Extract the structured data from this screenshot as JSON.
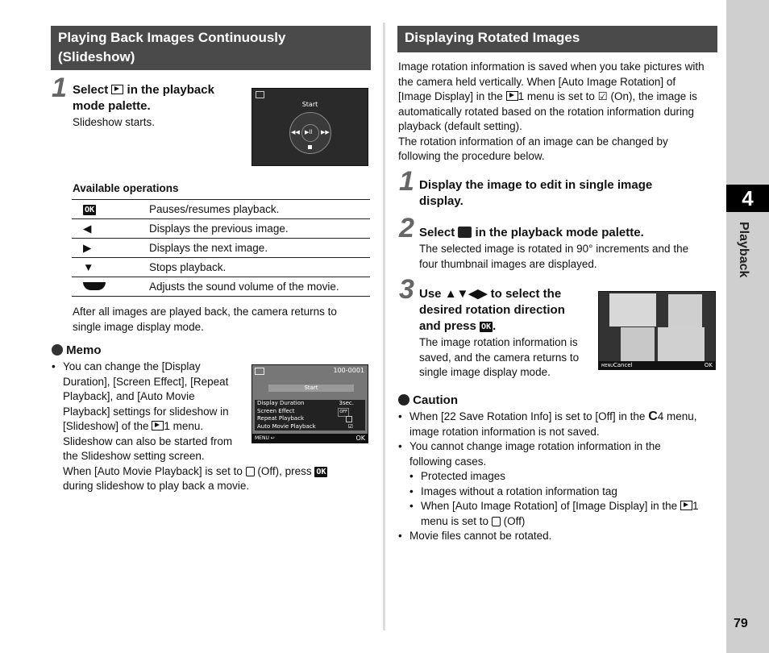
{
  "left": {
    "section_title_line1": "Playing Back Images Continuously",
    "section_title_line2": "(Slideshow)",
    "step1": {
      "number": "1",
      "title_prefix": "Select",
      "title_icon": "slideshow-icon",
      "title_suffix": "in the playback",
      "title_line2": "mode palette.",
      "body": "Slideshow starts."
    },
    "screen1": {
      "label": "Start"
    },
    "operations": {
      "heading": "Available operations",
      "rows": [
        {
          "key_icon": "ok-button-icon",
          "key_text": "OK",
          "desc": "Pauses/resumes playback."
        },
        {
          "key_icon": "left-arrow-icon",
          "key_text": "◀",
          "desc": "Displays the previous image."
        },
        {
          "key_icon": "right-arrow-icon",
          "key_text": "▶",
          "desc": "Displays the next image."
        },
        {
          "key_icon": "down-arrow-icon",
          "key_text": "▼",
          "desc": "Stops playback."
        },
        {
          "key_icon": "rear-dial-icon",
          "key_text": "",
          "desc": "Adjusts the sound volume of the movie."
        }
      ]
    },
    "after_text_line1": "After all images are played back, the camera returns to",
    "after_text_line2": "single image display mode.",
    "memo": {
      "title": "Memo",
      "lines": [
        "You can change the [Display",
        "Duration], [Screen Effect], [Repeat",
        "Playback], and [Auto Movie",
        "Playback] settings for slideshow in",
        "[Slideshow] of the",
        "1 menu.",
        "Slideshow can also be started from",
        "the Slideshow setting screen.",
        "When [Auto Movie Playback] is set to",
        "(Off), press",
        "during slideshow to play back a movie."
      ]
    },
    "screen2": {
      "file_no": "100-0001",
      "start": "Start",
      "settings": [
        {
          "name": "Display Duration",
          "value": "3sec."
        },
        {
          "name": "Screen Effect",
          "value": "OFF"
        },
        {
          "name": "Repeat Playback",
          "value": "unchecked"
        },
        {
          "name": "Auto Movie Playback",
          "value": "checked"
        }
      ],
      "menu_label": "MENU",
      "ok_label": "OK"
    }
  },
  "right": {
    "section_title": "Displaying Rotated Images",
    "intro_lines": [
      "Image rotation information is saved when you take pictures with",
      "the camera held vertically. When [Auto Image Rotation] of",
      "[Image Display] in the",
      "1 menu is set to",
      "(On), the image is",
      "automatically rotated based on the rotation information during",
      "playback (default setting).",
      "The rotation information of an image can be changed by",
      "following the procedure below."
    ],
    "step1": {
      "number": "1",
      "line1": "Display the image to edit in single image",
      "line2": "display."
    },
    "step2": {
      "number": "2",
      "title_prefix": "Select",
      "title_suffix": "in the playback mode palette.",
      "body_line1": "The selected image is rotated in 90° increments and the",
      "body_line2": "four thumbnail images are displayed."
    },
    "step3": {
      "number": "3",
      "line1_prefix": "Use",
      "arrows": "▲▼◀▶",
      "line1_suffix": "to select the",
      "line2": "desired rotation direction",
      "line3_prefix": "and press",
      "ok": "OK",
      "body_lines": [
        "The image rotation information is",
        "saved, and the camera returns to",
        "single image display mode."
      ]
    },
    "screen3": {
      "cancel": "Cancel",
      "menu": "MENU",
      "ok": "OK"
    },
    "caution": {
      "title": "Caution",
      "b1_prefix": "When [22 Save Rotation Info] is set to [Off] in the",
      "b1_c": "C",
      "b1_suffix": "4 menu,",
      "b1_line2": "image rotation information is not saved.",
      "b2_line1": "You cannot change image rotation information in the",
      "b2_line2": "following cases.",
      "sub1": "Protected images",
      "sub2": "Images without a rotation information tag",
      "sub3_prefix": "When [Auto Image Rotation] of [Image Display] in the",
      "sub3_suffix": "1",
      "sub3_line2_prefix": "menu is set to",
      "sub3_line2_suffix": "(Off)",
      "b3": "Movie files cannot be rotated."
    }
  },
  "side": {
    "chapter": "4",
    "label": "Playback",
    "page": "79"
  }
}
